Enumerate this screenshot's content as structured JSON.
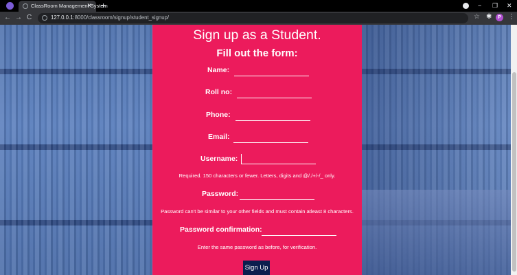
{
  "browser": {
    "tab_title": "ClassRoom Management System",
    "tab_close": "✕",
    "new_tab": "+",
    "url_host": "127.0.0.1",
    "url_path": ":8000/classroom/signup/student_signup/",
    "back": "←",
    "forward": "→",
    "reload": "C",
    "star": "☆",
    "extensions": "✱",
    "avatar_letter": "P",
    "menu": "⋮",
    "minimize": "−",
    "maximize": "❐",
    "close": "✕"
  },
  "form": {
    "title": "Sign up as a Student.",
    "subtitle": "Fill out the form:",
    "fields": {
      "name": {
        "label": "Name:",
        "value": ""
      },
      "roll_no": {
        "label": "Roll no:",
        "value": ""
      },
      "phone": {
        "label": "Phone:",
        "value": ""
      },
      "email": {
        "label": "Email:",
        "value": ""
      },
      "username": {
        "label": "Username:",
        "value": ""
      },
      "password": {
        "label": "Password:",
        "value": ""
      },
      "password_confirmation": {
        "label": "Password confirmation:",
        "value": ""
      }
    },
    "help": {
      "username": "Required. 150 characters or fewer. Letters, digits and @/./+/-/_ only.",
      "password": "Password can't be similar to your other fields and must contain atleast 8 characters.",
      "password_confirmation": "Enter the same password as before, for verification."
    },
    "submit_label": "Sign Up"
  },
  "colors": {
    "panel": "#ec1b5c",
    "button": "#0b1e4e",
    "background_tint": "#5077b6"
  }
}
